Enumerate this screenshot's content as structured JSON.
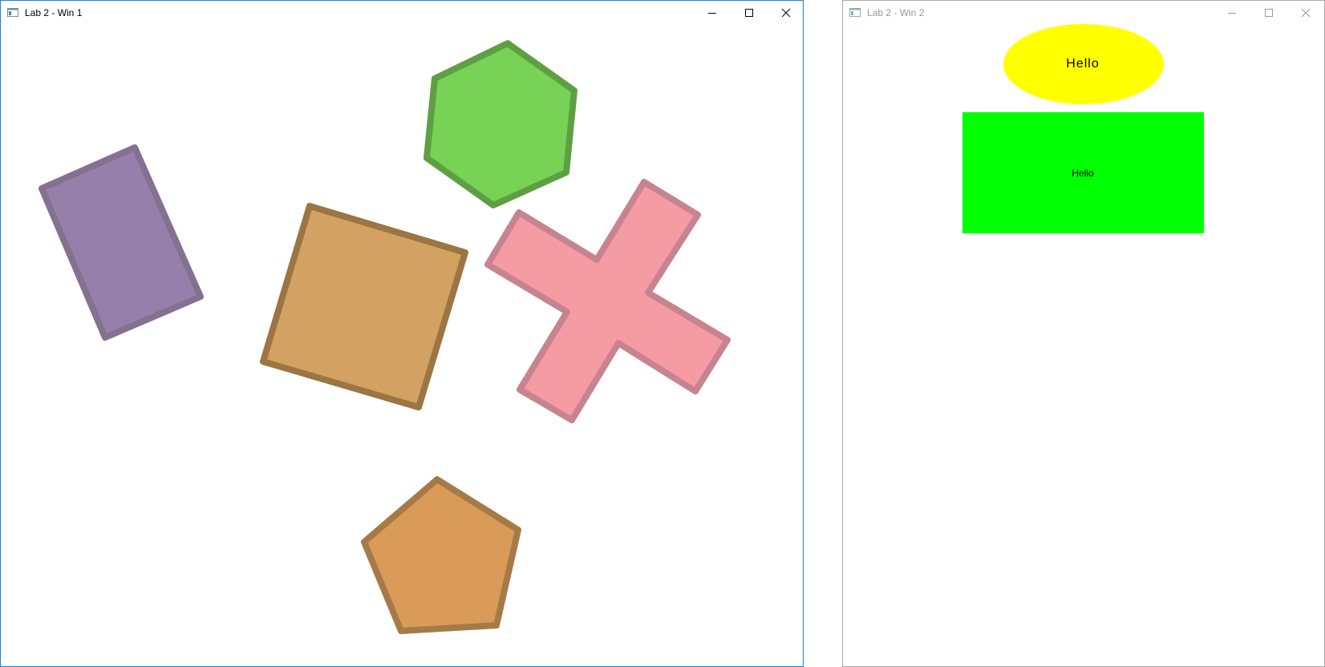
{
  "windows": [
    {
      "title": "Lab 2 - Win 1",
      "focused": true
    },
    {
      "title": "Lab 2 - Win 2",
      "focused": false,
      "ellipse_text": "Hello",
      "rect_text": "Hello"
    }
  ],
  "colors": {
    "active_border": "#1883d7",
    "inactive_border": "#aaaaaa",
    "rectangle_fill": "#977fab",
    "rectangle_stroke": "#85708f",
    "square_fill": "#d3a262",
    "square_stroke": "#9b7543",
    "hexagon_fill": "#77d255",
    "hexagon_stroke": "#5f9f44",
    "cross_fill": "#f59ba4",
    "cross_stroke": "#c78490",
    "pentagon_fill": "#d99b57",
    "pentagon_stroke": "#a67a48",
    "ellipse_fill": "#ffff00",
    "green_rect_fill": "#00ff00"
  },
  "icons": {
    "app": "app-window-icon",
    "minimize": "minimize-icon",
    "maximize": "maximize-icon",
    "close": "close-icon"
  }
}
